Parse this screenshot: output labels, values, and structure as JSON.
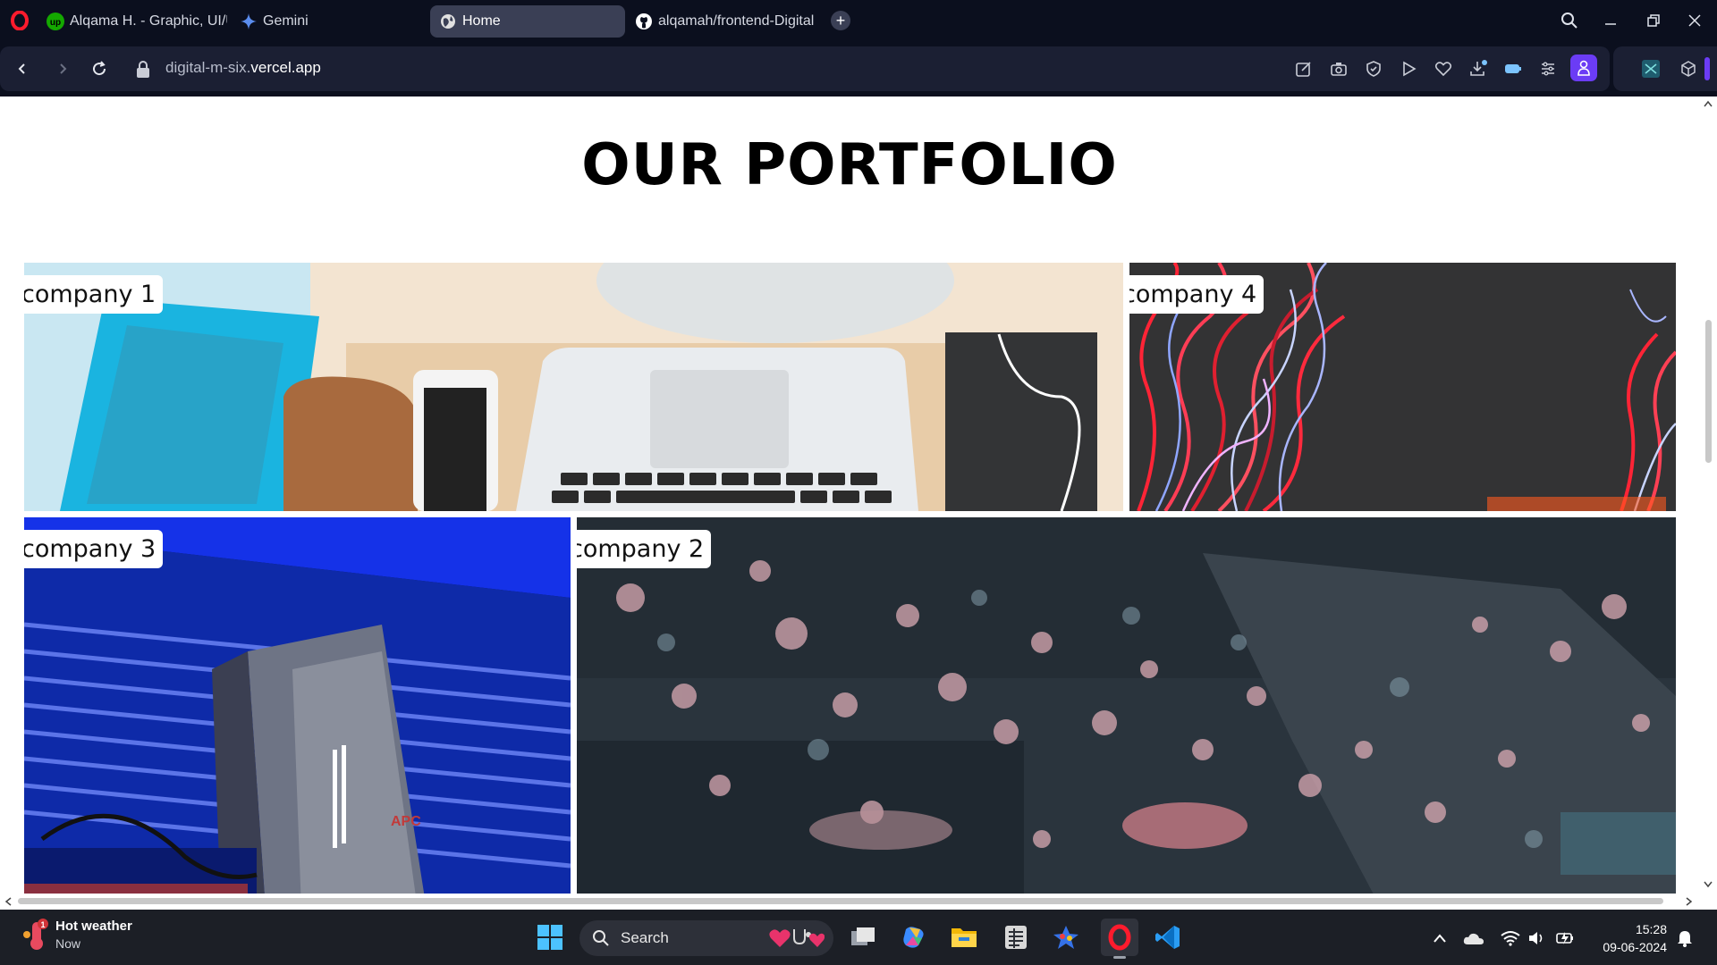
{
  "browser": {
    "tabs": [
      {
        "label": "Alqama H. - Graphic, UI/U",
        "icon": "upwork-icon",
        "active": false
      },
      {
        "label": "Gemini",
        "icon": "gemini-icon",
        "active": false
      },
      {
        "label": "Home",
        "icon": "globe-icon",
        "active": true
      },
      {
        "label": "alqamah/frontend-Digital",
        "icon": "github-icon",
        "active": false
      }
    ],
    "url_prefix": "digital-m-six.",
    "url_domain": "vercel.app",
    "accent_color": "#6b3cf5"
  },
  "page": {
    "title": "OUR PORTFOLIO",
    "tiles": [
      {
        "label": "company 1",
        "image": "desk-laptop-photo"
      },
      {
        "label": "company 4",
        "image": "light-trails-photo"
      },
      {
        "label": "company 3",
        "image": "server-rack-photo"
      },
      {
        "label": "company 2",
        "image": "circuit-bokeh-photo"
      }
    ]
  },
  "taskbar": {
    "weather_title": "Hot weather",
    "weather_sub": "Now",
    "search_label": "Search",
    "time": "15:28",
    "date": "09-06-2024"
  }
}
